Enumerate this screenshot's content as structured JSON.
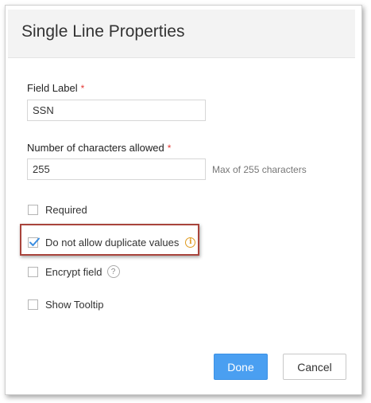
{
  "dialog": {
    "title": "Single Line Properties"
  },
  "field_label": {
    "label": "Field Label",
    "required_mark": "*",
    "value": "SSN"
  },
  "max_chars": {
    "label": "Number of characters allowed",
    "required_mark": "*",
    "value": "255",
    "hint": "Max of 255 characters"
  },
  "options": {
    "required": {
      "label": "Required",
      "checked": false
    },
    "no_duplicates": {
      "label": "Do not allow duplicate values",
      "checked": true,
      "icon": "info-icon"
    },
    "encrypt": {
      "label": "Encrypt field",
      "checked": false,
      "icon": "help-icon",
      "icon_glyph": "?"
    },
    "tooltip": {
      "label": "Show Tooltip",
      "checked": false
    }
  },
  "buttons": {
    "done": "Done",
    "cancel": "Cancel"
  },
  "colors": {
    "primary": "#4a9ff1",
    "required": "#e53935",
    "highlight": "#a9443c",
    "info": "#e09a1d"
  }
}
